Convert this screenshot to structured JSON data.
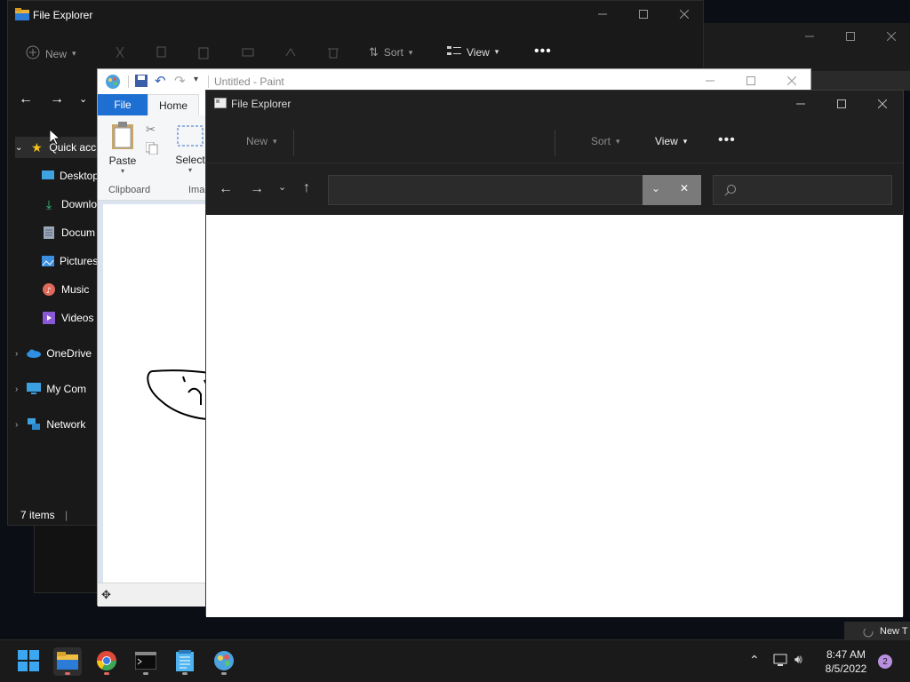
{
  "explorer_back": {
    "title": "File Explorer",
    "toolbar": {
      "new_label": "New",
      "sort_label": "Sort",
      "view_label": "View"
    },
    "sidebar": {
      "quick_access": "Quick acc",
      "items": [
        {
          "label": "Desktop",
          "icon": "desktop-icon"
        },
        {
          "label": "Downlo",
          "icon": "download-icon"
        },
        {
          "label": "Docum",
          "icon": "document-icon"
        },
        {
          "label": "Pictures",
          "icon": "pictures-icon"
        },
        {
          "label": "Music",
          "icon": "music-icon"
        },
        {
          "label": "Videos",
          "icon": "videos-icon"
        }
      ],
      "onedrive": "OneDrive",
      "mycomputer": "My Com",
      "network": "Network"
    },
    "status": "7 items"
  },
  "paint": {
    "title": "Untitled - Paint",
    "tab_file": "File",
    "tab_home": "Home",
    "paste_label": "Paste",
    "select_label": "Select",
    "clipboard_group": "Clipboard",
    "image_group": "Imag"
  },
  "explorer_front": {
    "title": "File Explorer",
    "cmd": {
      "new_label": "New",
      "sort_label": "Sort",
      "view_label": "View"
    },
    "address_value": "",
    "search_value": ""
  },
  "taskbar": {
    "time": "8:47 AM",
    "date": "8/5/2022",
    "notification_count": "2",
    "toast_text": "New T"
  },
  "colors": {
    "paint_file_tab": "#1e6fd2",
    "taskbar_bg": "#1a1a1a",
    "explorer_bg": "#202020",
    "badge": "#b98fe0"
  }
}
